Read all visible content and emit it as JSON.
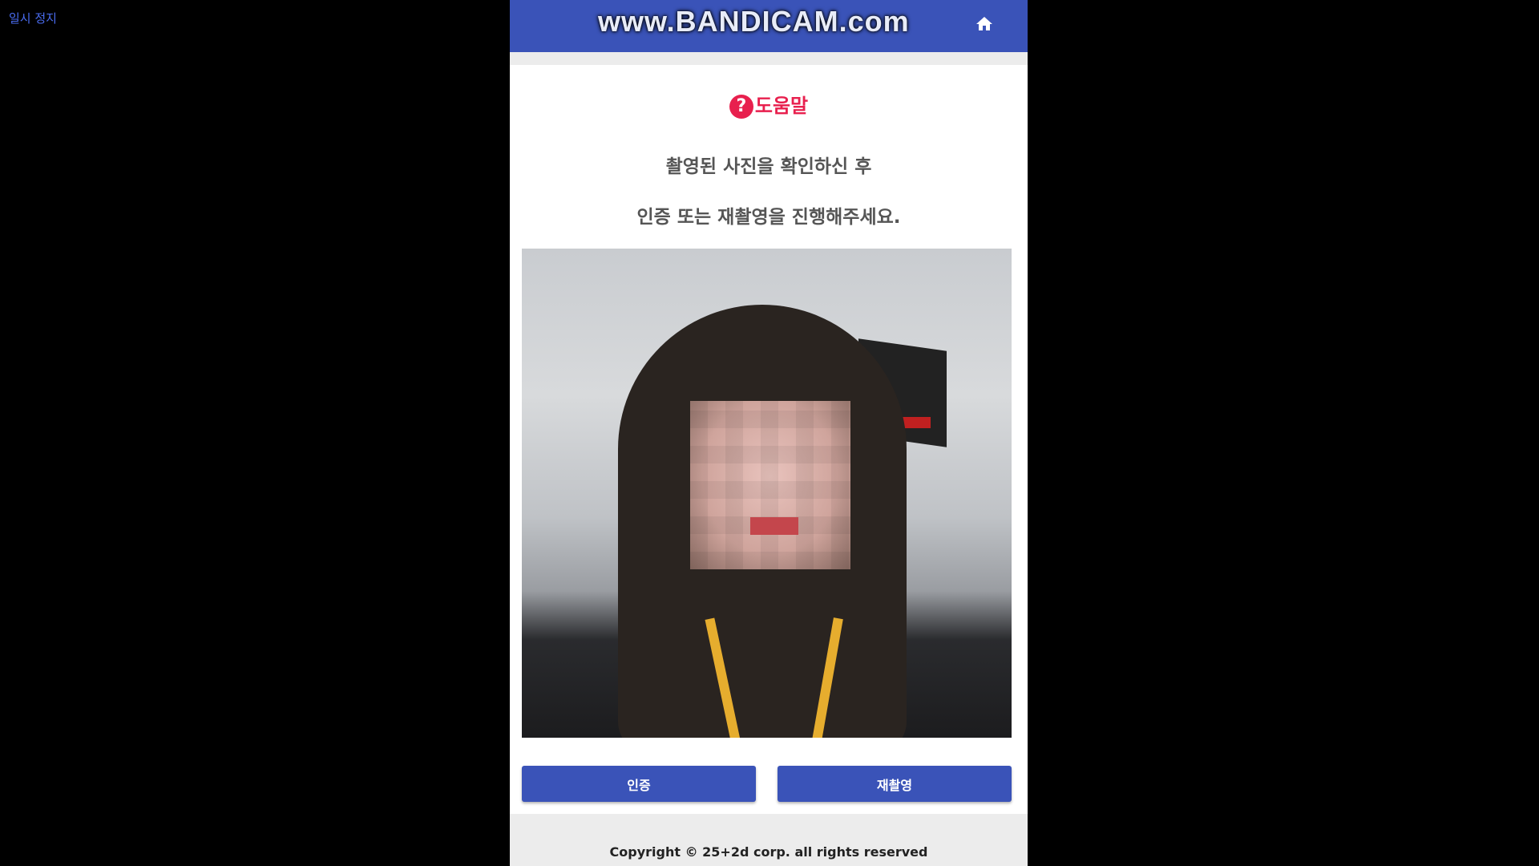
{
  "overlay": {
    "pause_label": "일시 정지"
  },
  "header": {
    "watermark": "www.BANDICAM.com",
    "home_icon": "home-icon"
  },
  "help": {
    "icon": "question-circle-icon",
    "title": "도움말"
  },
  "instructions": [
    "촬영된 사진을 확인하신 후",
    "인증 또는 재촬영을 진행해주세요."
  ],
  "buttons": {
    "verify": "인증",
    "retake": "재촬영"
  },
  "footer": {
    "copyright": "Copyright © 25+2d corp. all rights reserved"
  },
  "colors": {
    "primary": "#3a53b8",
    "help": "#e8204e"
  }
}
